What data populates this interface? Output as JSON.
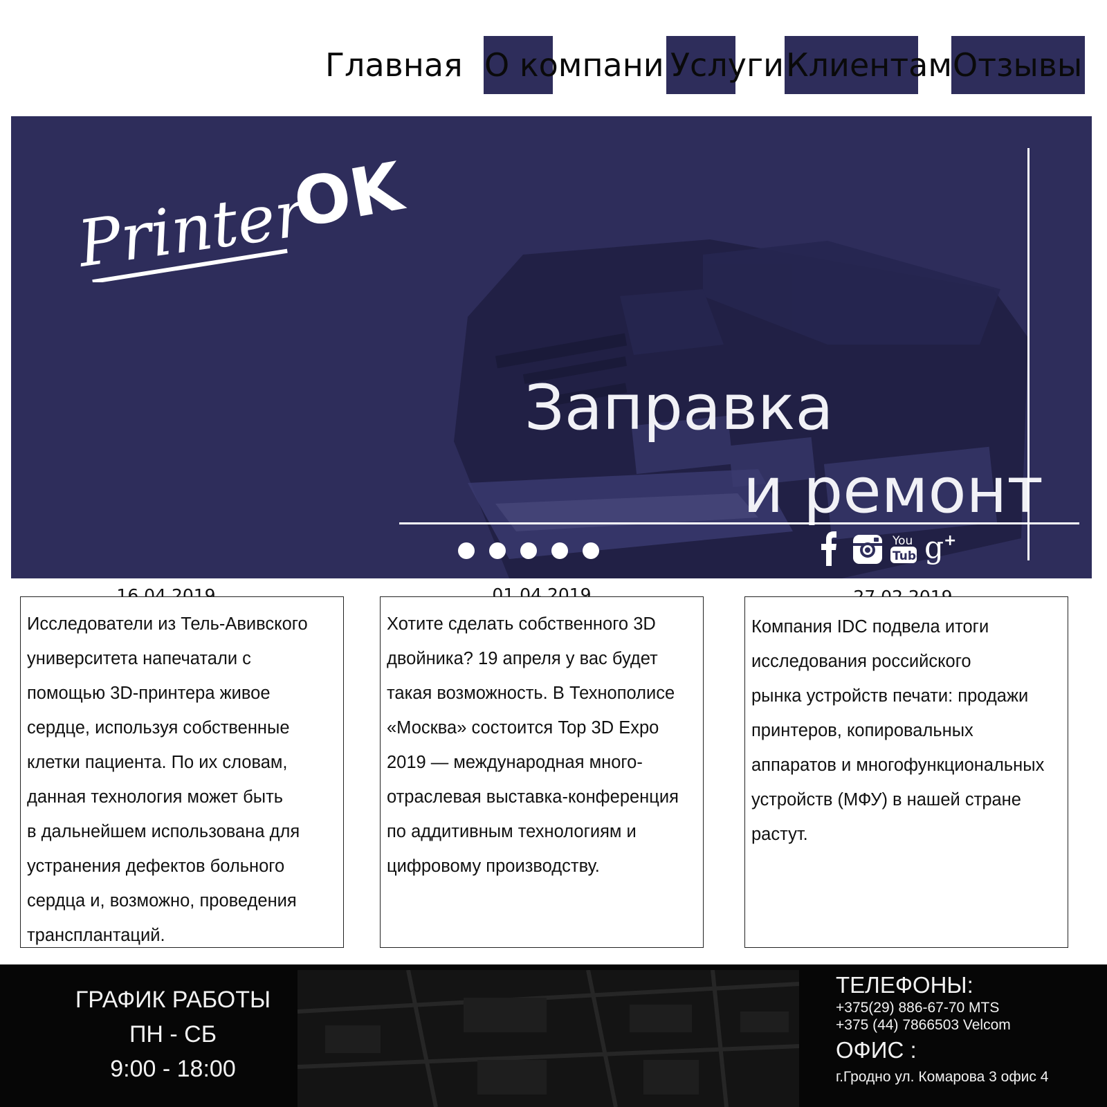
{
  "nav": {
    "items": [
      {
        "label": "Главная"
      },
      {
        "label": "О компани"
      },
      {
        "label": "Услуги"
      },
      {
        "label": "Клиентам"
      },
      {
        "label": "Отзывы"
      }
    ]
  },
  "hero": {
    "logo_text": "PrinterOK",
    "title_line1": "Заправка",
    "title_line2": "и ремонт",
    "slide_count": 5,
    "social": [
      "facebook-icon",
      "instagram-icon",
      "youtube-icon",
      "google-plus-icon"
    ]
  },
  "news": [
    {
      "date": "16.04.2019",
      "lines": [
        "Исследователи из Тель-Авивского",
        " университета напечатали с",
        "помощью 3D-принтера живое",
        "сердце, используя собственные",
        " клетки пациента. По их словам,",
        "данная технология может быть",
        "в дальнейшем использована для",
        "устранения дефектов больного",
        "сердца и,  возможно, проведения",
        " трансплантаций."
      ]
    },
    {
      "date": "01.04.2019",
      "lines": [
        "Хотите сделать собственного 3D",
        "двойника? 19 апреля у вас будет",
        "такая возможность. В Технополисе",
        "«Москва» состоится Top 3D Expo",
        "2019 — международная много-",
        "отраслевая выставка-конференция",
        "по аддитивным технологиям и",
        "цифровому производству."
      ]
    },
    {
      "date": "27.02.2019",
      "lines": [
        "Компания IDC подвела итоги",
        " исследования российского",
        "рынка устройств печати: продажи",
        " принтеров, копировальных",
        "аппаратов и многофункциональных",
        " устройств (МФУ) в нашей стране",
        "растут."
      ]
    }
  ],
  "footer": {
    "schedule_title": "ГРАФИК РАБОТЫ",
    "schedule_days": "ПН - СБ",
    "schedule_hours": "9:00 - 18:00",
    "phones_title": "ТЕЛЕФОНЫ:",
    "phone1": "+375(29) 886-67-70 MTS",
    "phone2": "+375 (44) 7866503  Velcom",
    "office_title": "ОФИС :",
    "office_address": "г.Гродно ул. Комарова 3 офис 4"
  },
  "colors": {
    "brand_navy": "#2e2d5b",
    "footer_bg": "#060606",
    "text_light": "#f2f2f2"
  }
}
